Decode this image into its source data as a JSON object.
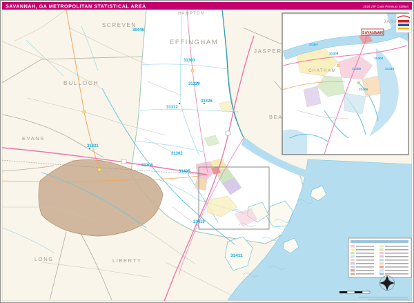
{
  "header": {
    "title": "SAVANNAH, GA METROPOLITAN STATISTICAL AREA",
    "edition": "2024 ZIP Code Premium Edition"
  },
  "colors": {
    "header_bar": "#c4006e",
    "zip_label": "#17a8d8",
    "county_label": "#a69d90",
    "water": "#b5ddf0",
    "military_area": "#c9ae92",
    "city_label": "#c42020",
    "interstate_road": "#ec74ac",
    "us_highway": "#f2a85c"
  },
  "map": {
    "county_labels": [
      "SCREVEN",
      "HAMPTON",
      "EFFINGHAM",
      "JASPER",
      "BULLOCH",
      "EVANS",
      "BEAUFORT",
      "LONG",
      "LIBERTY"
    ],
    "zip_labels": [
      "30446",
      "31303",
      "31329",
      "31326",
      "31312",
      "31321",
      "31302",
      "31308",
      "31405",
      "31419",
      "31411"
    ]
  },
  "inset": {
    "county_labels": [
      "JASPER",
      "CHATHAM"
    ],
    "city_label": "SAVANNAH",
    "zip_labels": [
      "31407",
      "31408",
      "31404",
      "31405",
      "31406",
      "31410"
    ]
  }
}
